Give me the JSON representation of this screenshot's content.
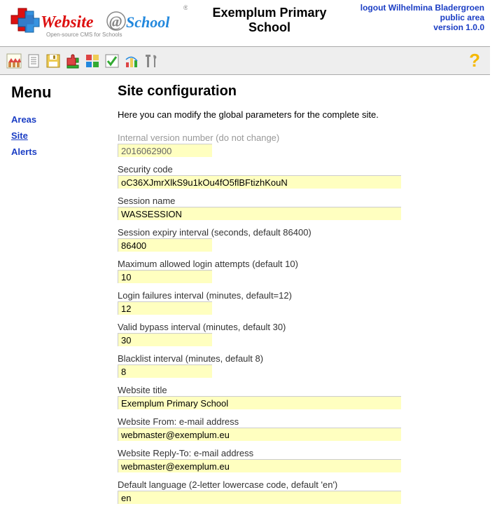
{
  "header": {
    "school_name": "Exemplum Primary School",
    "logout_text": "logout Wilhelmina Bladergroen",
    "public_area": "public area",
    "version": "version 1.0.0",
    "logo": {
      "text_website": "Website",
      "text_at": "@",
      "text_school": "School",
      "tagline": "Open-source CMS for Schools"
    }
  },
  "toolbar": {
    "icons": [
      {
        "name": "home-icon"
      },
      {
        "name": "document-icon"
      },
      {
        "name": "save-icon"
      },
      {
        "name": "puzzle-icon"
      },
      {
        "name": "modules-icon"
      },
      {
        "name": "check-icon"
      },
      {
        "name": "stats-icon"
      },
      {
        "name": "tools-icon"
      }
    ],
    "help": "?"
  },
  "sidebar": {
    "title": "Menu",
    "items": [
      {
        "label": "Areas",
        "active": false
      },
      {
        "label": "Site",
        "active": true
      },
      {
        "label": "Alerts",
        "active": false
      }
    ]
  },
  "content": {
    "title": "Site configuration",
    "intro": "Here you can modify the global parameters for the complete site.",
    "fields": [
      {
        "label": "Internal version number (do not change)",
        "value": "2016062900",
        "narrow": true,
        "disabled": true
      },
      {
        "label": "Security code",
        "value": "oC36XJmrXlkS9u1kOu4fO5flBFtizhKouN",
        "narrow": false,
        "disabled": false
      },
      {
        "label": "Session name",
        "value": "WASSESSION",
        "narrow": false,
        "disabled": false
      },
      {
        "label": "Session expiry interval (seconds, default 86400)",
        "value": "86400",
        "narrow": true,
        "disabled": false
      },
      {
        "label": "Maximum allowed login attempts (default 10)",
        "value": "10",
        "narrow": true,
        "disabled": false
      },
      {
        "label": "Login failures interval (minutes, default=12)",
        "value": "12",
        "narrow": true,
        "disabled": false
      },
      {
        "label": "Valid bypass interval (minutes, default 30)",
        "value": "30",
        "narrow": true,
        "disabled": false
      },
      {
        "label": "Blacklist interval (minutes, default 8)",
        "value": "8",
        "narrow": true,
        "disabled": false
      },
      {
        "label": "Website title",
        "value": "Exemplum Primary School",
        "narrow": false,
        "disabled": false
      },
      {
        "label": "Website From: e-mail address",
        "value": "webmaster@exemplum.eu",
        "narrow": false,
        "disabled": false
      },
      {
        "label": "Website Reply-To: e-mail address",
        "value": "webmaster@exemplum.eu",
        "narrow": false,
        "disabled": false
      },
      {
        "label": "Default language (2-letter lowercase code, default 'en')",
        "value": "en",
        "narrow": false,
        "disabled": false
      }
    ]
  }
}
